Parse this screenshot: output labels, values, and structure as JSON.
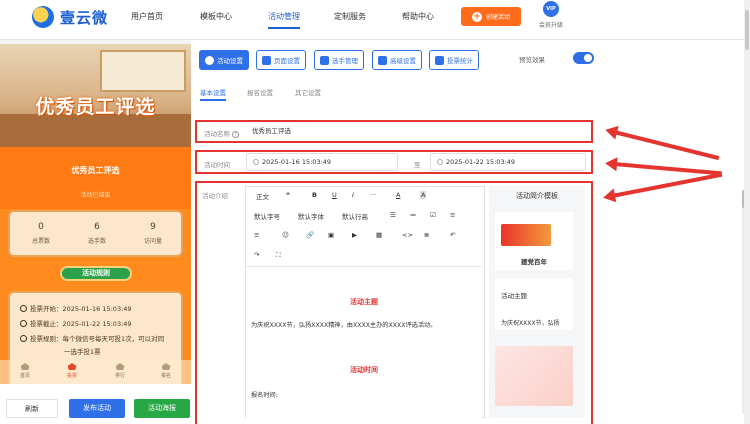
{
  "app": {
    "logo_text": "壹云微"
  },
  "nav": [
    {
      "label": "用户首页"
    },
    {
      "label": "模板中心"
    },
    {
      "label": "活动管理"
    },
    {
      "label": "定制服务"
    },
    {
      "label": "帮助中心"
    }
  ],
  "header": {
    "create_label": "创建活动",
    "vip_badge": "VIP",
    "vip_label": "会员升级"
  },
  "preview": {
    "banner_title": "优秀员工评选",
    "activity_title": "优秀员工评选",
    "activity_subtitle": "活动已结束",
    "stats": [
      {
        "value": "0",
        "label": "总票数"
      },
      {
        "value": "6",
        "label": "选手数"
      },
      {
        "value": "9",
        "label": "访问量"
      }
    ],
    "rules_button": "活动规则",
    "rules": [
      "投票开始：2025-01-16 15:03:49",
      "投票截止：2025-01-22 15:03:49",
      "投票规则：每个微信号每天可投1次，可以对同",
      "一选手投1票"
    ],
    "bottom_tabs": [
      "首页",
      "投票",
      "排行",
      "报名"
    ]
  },
  "footer_buttons": {
    "refresh": "刷新",
    "publish": "发布活动",
    "poster": "活动海报"
  },
  "toolbar": {
    "buttons": [
      "活动设置",
      "页面设置",
      "选手管理",
      "高级设置",
      "投票统计"
    ],
    "preview_label": "预览效果"
  },
  "subtabs": [
    "基本设置",
    "报名设置",
    "其它设置"
  ],
  "form": {
    "name_label": "活动名称",
    "name_value": "优秀员工评选",
    "time_label": "活动时间",
    "start_time": "2025-01-16 15:03:49",
    "time_separator": "至",
    "end_time": "2025-01-22 15:03:49",
    "intro_label": "活动介绍"
  },
  "editor": {
    "toolbar_row1": [
      "正文",
      "❝",
      "B",
      "U",
      "I",
      "···",
      "A",
      "A"
    ],
    "toolbar_row2": [
      "默认字号",
      "默认字体",
      "默认行高",
      "☰",
      "≔",
      "☑",
      "≡"
    ],
    "toolbar_row3": [
      "≡",
      "☺",
      "🔗",
      "▣",
      "▶",
      "▦",
      "<>",
      "≣",
      "↶"
    ],
    "toolbar_row4": [
      "↷",
      "⛶"
    ],
    "heading1": "活动主题",
    "paragraph1": "为庆祝XXXX节，弘扬XXXX精神，由XXXX主办的XXXX评选活动。",
    "heading2": "活动时间",
    "paragraph2": "报名时间:"
  },
  "template_panel": {
    "title": "活动简介模板",
    "card1_text": "建党百年",
    "card2_title": "活动主题",
    "card2_text": "为庆祝XXXX节，弘扬"
  },
  "colors": {
    "accent": "#2f6fe8",
    "orange": "#ff6b1a",
    "highlight": "#e3342f"
  }
}
